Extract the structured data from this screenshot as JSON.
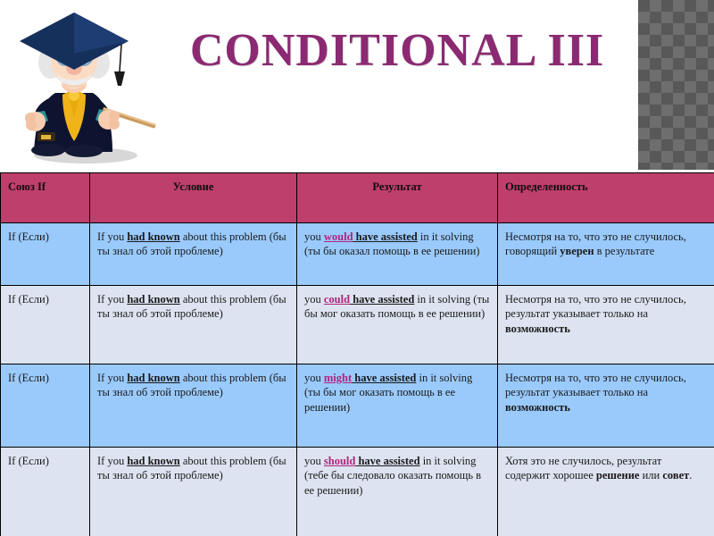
{
  "slide": {
    "title": "CONDITIONAL  III",
    "title_color": "#8b2a72",
    "header_color": "#bf3f6c",
    "row_blue_color": "#9acafc",
    "row_light_color": "#dde3f0",
    "deco_color": "#585858",
    "illustration": "professor-graduation-cap-pointer-clipart"
  },
  "table": {
    "headers": [
      "Союз If",
      "Условие",
      "Результат",
      "Определенность"
    ],
    "rows": [
      {
        "conjunction": "If (Если)",
        "condition": {
          "pre": "If you ",
          "kw": "had known",
          "post": " about this problem (бы ты знал об этой проблеме)"
        },
        "result": {
          "pre": "you ",
          "modal": "would",
          "kw": " have assisted",
          "post": " in it solving (ты бы оказал помощь в ее решении)"
        },
        "certainty": {
          "pre": "Несмотря на то, что это не случилось, говорящий ",
          "bold": "уверен",
          "post": " в результате"
        }
      },
      {
        "conjunction": "If (Если)",
        "condition": {
          "pre": "If you ",
          "kw": "had known",
          "post": " about this problem (бы ты знал об этой проблеме)"
        },
        "result": {
          "pre": "you ",
          "modal": "could",
          "kw": " have assisted",
          "post": " in it solving (ты бы мог оказать помощь в ее решении)"
        },
        "certainty": {
          "pre": "Несмотря на то, что это не случилось, результат указывает только на ",
          "bold": "возможность",
          "post": ""
        }
      },
      {
        "conjunction": "If (Если)",
        "condition": {
          "pre": "If you ",
          "kw": "had known",
          "post": " about this problem (бы ты знал об этой проблеме)"
        },
        "result": {
          "pre": "you ",
          "modal": "might",
          "kw": " have assisted",
          "post": " in it solving (ты бы мог оказать помощь в ее решении)"
        },
        "certainty": {
          "pre": "Несмотря на то, что это не случилось, результат указывает только на ",
          "bold": "возможность",
          "post": ""
        }
      },
      {
        "conjunction": "If (Если)",
        "condition": {
          "pre": "If you ",
          "kw": "had known",
          "post": " about this problem (бы ты знал об этой проблеме)"
        },
        "result": {
          "pre": "you ",
          "modal": "should",
          "kw": " have assisted",
          "post": " in it solving (тебе бы следовало оказать помощь в ее решении)"
        },
        "certainty": {
          "pre": "Хотя это не случилось, результат содержит хорошее ",
          "bold": "решение",
          "mid": " или ",
          "bold2": "совет",
          "post": "."
        }
      }
    ]
  }
}
